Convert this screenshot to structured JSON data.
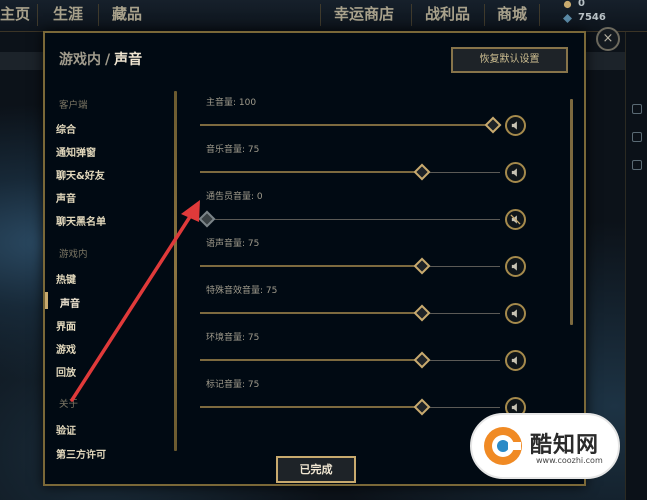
{
  "topbar": {
    "nav": [
      "主页",
      "生涯",
      "藏品",
      "幸运商店",
      "战利品",
      "商城"
    ],
    "currency_top": "0",
    "currency_bottom": "7546"
  },
  "close_label": "×",
  "modal": {
    "title_parent": "游戏内",
    "title_sep": "/",
    "title_current": "声音",
    "reset_label": "恢复默认设置",
    "done_label": "已完成"
  },
  "nav": {
    "client_section": "客户端",
    "client_items": [
      "综合",
      "通知弹窗",
      "聊天&好友",
      "声音",
      "聊天黑名单"
    ],
    "ingame_section": "游戏内",
    "ingame_items": [
      "热键",
      "声音",
      "界面",
      "游戏",
      "回放"
    ],
    "about_section": "关于",
    "about_items": [
      "验证",
      "第三方许可"
    ],
    "active_item": "声音"
  },
  "volumes": [
    {
      "label": "主音量: 100",
      "value": 100
    },
    {
      "label": "音乐音量: 75",
      "value": 75
    },
    {
      "label": "通告员音量: 0",
      "value": 0
    },
    {
      "label": "语声音量: 75",
      "value": 75
    },
    {
      "label": "特殊音效音量: 75",
      "value": 75
    },
    {
      "label": "环境音量: 75",
      "value": 75
    },
    {
      "label": "标记音量: 75",
      "value": 75
    }
  ],
  "watermark": {
    "text": "酷知网",
    "url": "www.coozhi.com"
  },
  "colors": {
    "gold": "#c8aa6e",
    "arrow": "#e03a3a",
    "modal_bg": "#010a13"
  }
}
